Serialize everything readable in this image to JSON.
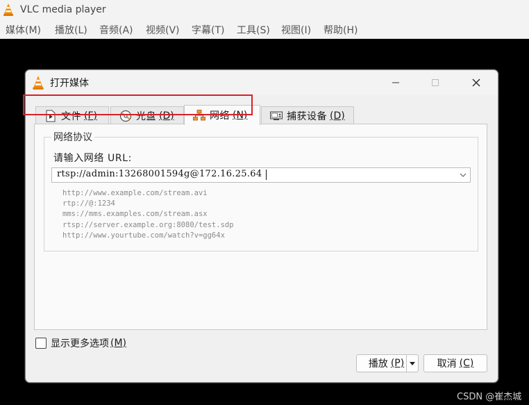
{
  "app": {
    "title": "VLC media player",
    "menu": [
      "媒体(M)",
      "播放(L)",
      "音频(A)",
      "视频(V)",
      "字幕(T)",
      "工具(S)",
      "视图(I)",
      "帮助(H)"
    ]
  },
  "dialog": {
    "title": "打开媒体",
    "tabs": [
      {
        "label": "文件",
        "hotkey": "(F)",
        "icon": "file-play-icon",
        "active": false
      },
      {
        "label": "光盘",
        "hotkey": "(D)",
        "icon": "disc-icon",
        "active": false
      },
      {
        "label": "网络",
        "hotkey": "(N)",
        "icon": "network-icon",
        "active": true
      },
      {
        "label": "捕获设备",
        "hotkey": "(D)",
        "icon": "capture-device-icon",
        "active": false
      }
    ],
    "network": {
      "group_title": "网络协议",
      "url_label": "请输入网络 URL:",
      "url_value": "rtsp://admin:13268001594g@172.16.25.64",
      "examples": [
        "http://www.example.com/stream.avi",
        "rtp://@:1234",
        "mms://mms.examples.com/stream.asx",
        "rtsp://server.example.org:8080/test.sdp",
        "http://www.yourtube.com/watch?v=gg64x"
      ]
    },
    "more_options": {
      "label": "显示更多选项",
      "hotkey": "(M)",
      "checked": false
    },
    "buttons": {
      "play": {
        "label": "播放",
        "hotkey": "(P)"
      },
      "cancel": {
        "label": "取消",
        "hotkey": "(C)"
      }
    }
  },
  "watermark": "CSDN @崔杰城",
  "colors": {
    "highlight": "#d92027",
    "vlc_orange": "#f08a00"
  }
}
